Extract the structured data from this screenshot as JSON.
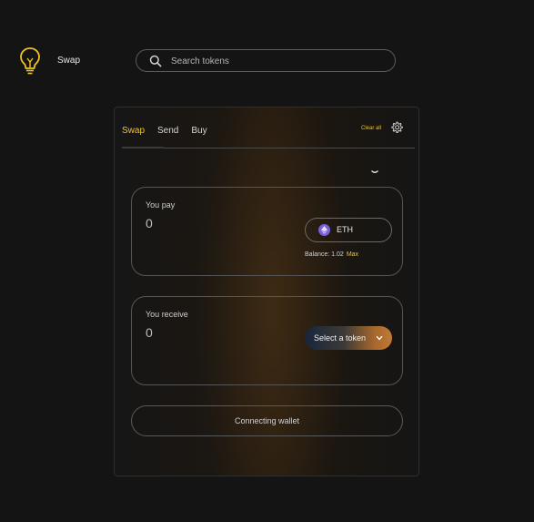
{
  "brand": {
    "name": "Swap",
    "logo_icon": "lightbulb-icon",
    "accent": "#f2c322"
  },
  "search": {
    "placeholder": "Search tokens",
    "value": "",
    "icon": "search-icon"
  },
  "swap_card": {
    "tabs": [
      {
        "label": "Swap",
        "active": true
      },
      {
        "label": "Send",
        "active": false
      },
      {
        "label": "Buy",
        "active": false
      }
    ],
    "clear_all": "Clear all",
    "settings_icon": "gear-icon",
    "pay": {
      "label": "You pay",
      "amount": "0",
      "token": {
        "symbol": "ETH",
        "icon": "eth-icon",
        "color": "#7b61d6"
      },
      "balance_label": "Balance: 1.02",
      "max_label": "Max"
    },
    "receive": {
      "label": "You receive",
      "amount": "0",
      "select_label": "Select a token"
    },
    "connect_label": "Connecting wallet"
  }
}
